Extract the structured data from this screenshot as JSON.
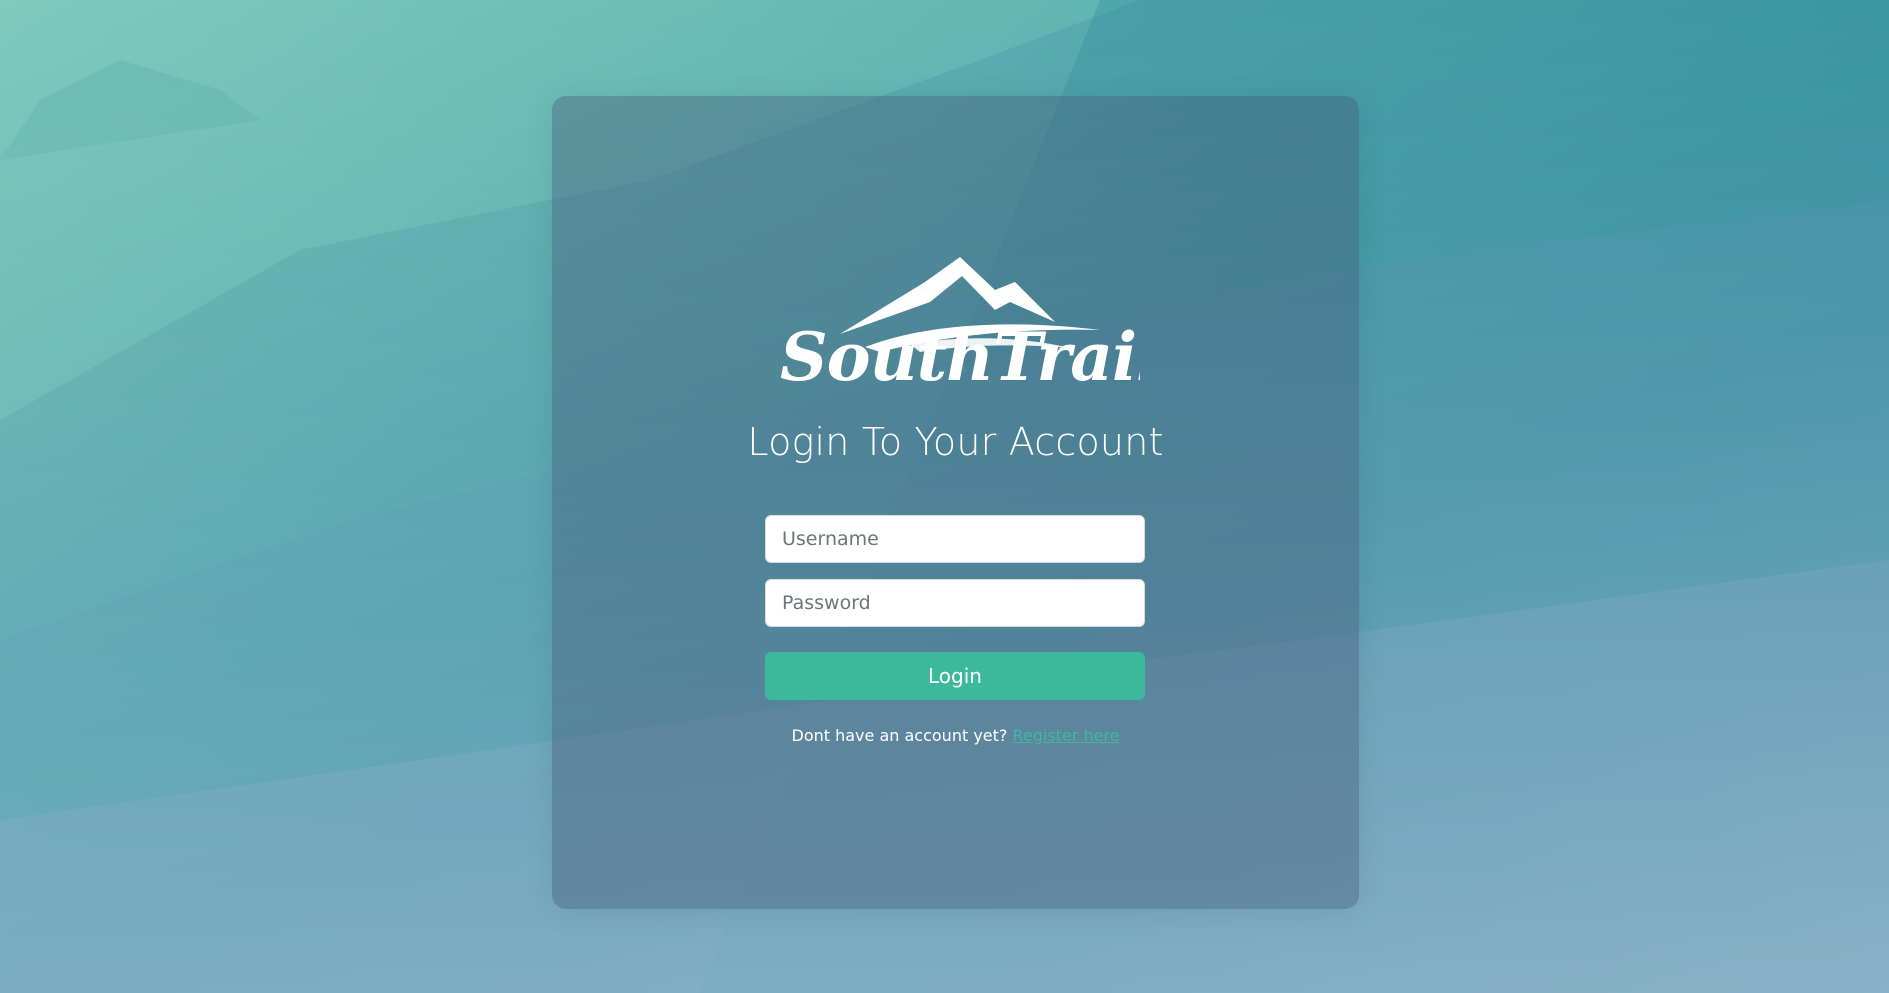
{
  "brand": {
    "logo_text": "SouthTrails",
    "logo_icon": "mountain-logo-icon"
  },
  "form": {
    "title": "Login To Your Account",
    "username_placeholder": "Username",
    "password_placeholder": "Password",
    "login_label": "Login",
    "register_prompt": "Dont have an account yet?",
    "register_link": "Register here"
  },
  "colors": {
    "accent": "#3cb99a",
    "card_overlay": "rgba(70, 90, 120, 0.42)",
    "text": "#ffffff"
  }
}
